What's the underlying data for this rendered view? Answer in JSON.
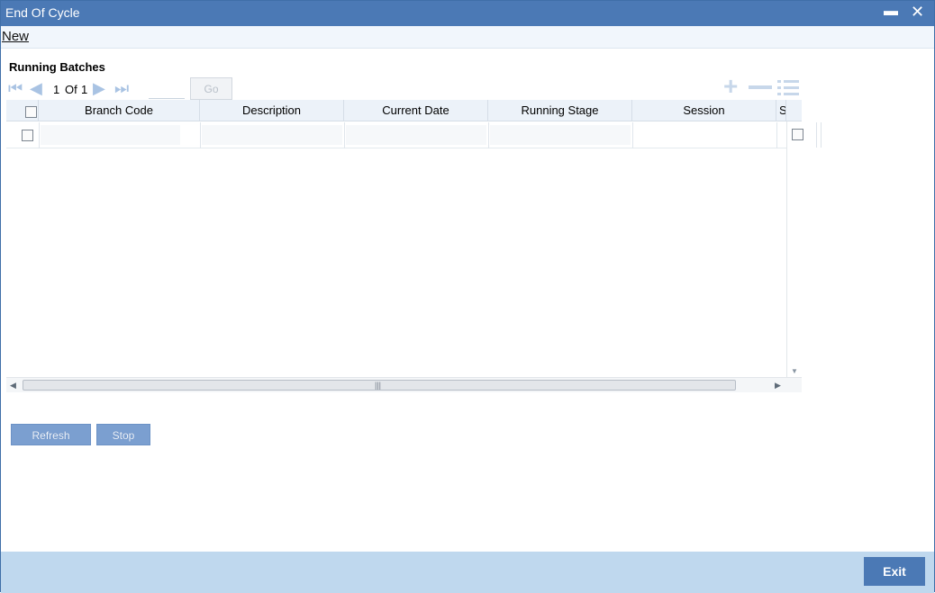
{
  "window": {
    "title": "End Of Cycle",
    "minimize_glyph": "▬",
    "close_glyph": "✕"
  },
  "menu": {
    "new_label": "New"
  },
  "section": {
    "title": "Running Batches"
  },
  "pager": {
    "current": "1",
    "of_label": "Of",
    "total": "1",
    "go_label": "Go",
    "goto_value": ""
  },
  "grid": {
    "columns": [
      "Branch Code",
      "Description",
      "Current Date",
      "Running Stage",
      "Session",
      "S"
    ],
    "rows": [
      {
        "branch_code": "",
        "description": "",
        "current_date": "",
        "running_stage": "",
        "session": ""
      }
    ]
  },
  "actions": {
    "refresh_label": "Refresh",
    "stop_label": "Stop",
    "exit_label": "Exit"
  },
  "colors": {
    "titlebar": "#4b79b5",
    "footer": "#bfd8ee",
    "secondary_button": "#7b9fd0"
  }
}
